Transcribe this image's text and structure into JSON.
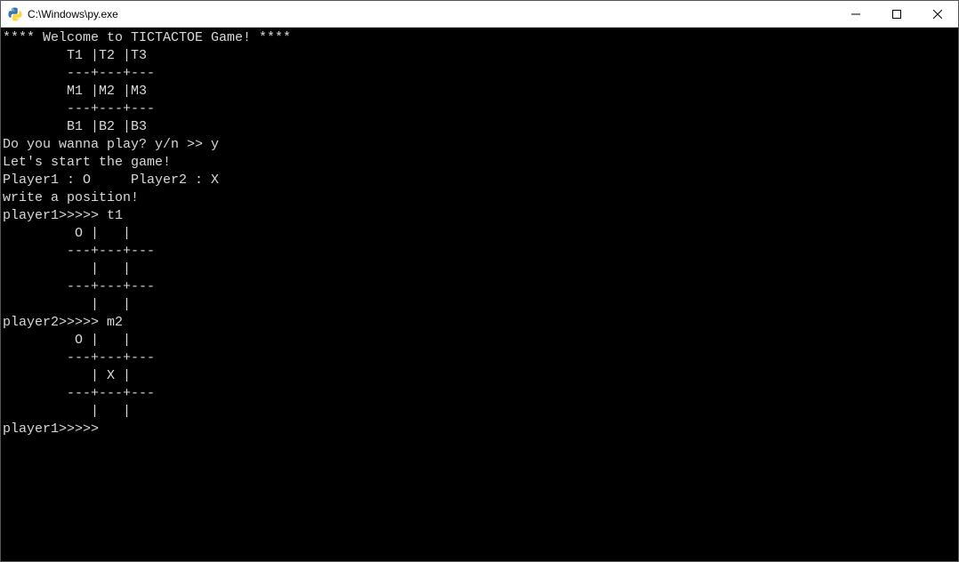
{
  "window": {
    "title": "C:\\Windows\\py.exe"
  },
  "console": {
    "lines": [
      "**** Welcome to TICTACTOE Game! ****",
      "        T1 |T2 |T3",
      "        ---+---+---",
      "        M1 |M2 |M3",
      "        ---+---+---",
      "        B1 |B2 |B3",
      "Do you wanna play? y/n >> y",
      "",
      "Let's start the game!",
      "Player1 : O     Player2 : X",
      "write a position!",
      "",
      "player1>>>>> t1",
      "         O |   |  ",
      "        ---+---+---",
      "           |   |  ",
      "        ---+---+---",
      "           |   |  ",
      "player2>>>>> m2",
      "         O |   |  ",
      "        ---+---+---",
      "           | X |  ",
      "        ---+---+---",
      "           |   |  ",
      "player1>>>>>"
    ]
  }
}
